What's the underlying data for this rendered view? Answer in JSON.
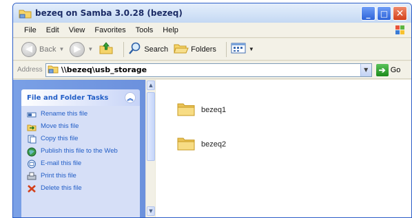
{
  "window": {
    "title": "bezeq on Samba 3.0.28 (bezeq)"
  },
  "menu": [
    "File",
    "Edit",
    "View",
    "Favorites",
    "Tools",
    "Help"
  ],
  "toolbar": {
    "back_label": "Back",
    "search_label": "Search",
    "folders_label": "Folders"
  },
  "address": {
    "label": "Address",
    "path": "\\\\bezeq\\usb_storage",
    "go_label": "Go"
  },
  "tasks_panel": {
    "header": "File and Folder Tasks",
    "items": [
      {
        "label": "Rename this file",
        "icon": "rename-icon"
      },
      {
        "label": "Move this file",
        "icon": "move-icon"
      },
      {
        "label": "Copy this file",
        "icon": "copy-icon"
      },
      {
        "label": "Publish this file to the Web",
        "icon": "globe-icon"
      },
      {
        "label": "E-mail this file",
        "icon": "email-icon"
      },
      {
        "label": "Print this file",
        "icon": "print-icon"
      },
      {
        "label": "Delete this file",
        "icon": "delete-icon"
      }
    ]
  },
  "folders": [
    {
      "name": "bezeq1"
    },
    {
      "name": "bezeq2"
    }
  ],
  "colors": {
    "taskpane_blue": "#7aa0e6",
    "task_link": "#215dc6",
    "folder_yellow": "#f5d46a"
  }
}
